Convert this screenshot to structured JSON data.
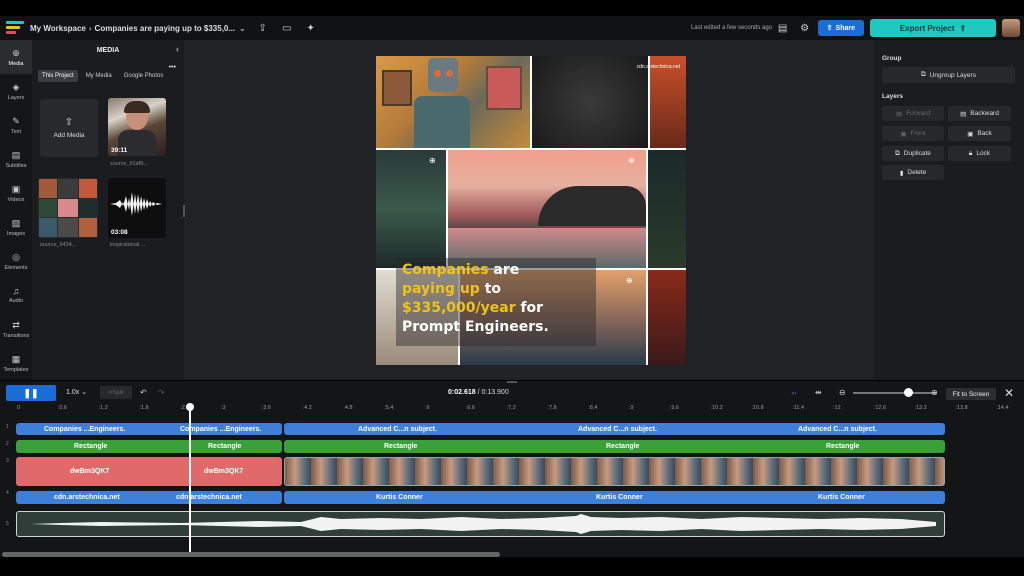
{
  "topbar": {
    "workspace": "My Workspace",
    "project": "Companies are paying up to $335,0...",
    "last_edited": "Last edited a few seconds ago",
    "share_label": "Share",
    "export_label": "Export Project",
    "logo_colors": [
      "#1fc8c0",
      "#f1c21b",
      "#e04f5f"
    ]
  },
  "leftnav": {
    "items": [
      {
        "label": "Media",
        "icon": "media-icon",
        "glyph": "⊕"
      },
      {
        "label": "Layers",
        "icon": "layers-icon",
        "glyph": "◈"
      },
      {
        "label": "Text",
        "icon": "text-icon",
        "glyph": "✎"
      },
      {
        "label": "Subtitles",
        "icon": "subtitles-icon",
        "glyph": "▤"
      },
      {
        "label": "Videos",
        "icon": "videos-icon",
        "glyph": "▣"
      },
      {
        "label": "Images",
        "icon": "images-icon",
        "glyph": "▨"
      },
      {
        "label": "Elements",
        "icon": "elements-icon",
        "glyph": "◎"
      },
      {
        "label": "Audio",
        "icon": "audio-icon",
        "glyph": "♫"
      },
      {
        "label": "Transitions",
        "icon": "transitions-icon",
        "glyph": "⇄"
      },
      {
        "label": "Templates",
        "icon": "templates-icon",
        "glyph": "▦"
      }
    ]
  },
  "media": {
    "title": "MEDIA",
    "tabs": [
      "This Project",
      "My Media",
      "Google Photos"
    ],
    "add_label": "Add Media",
    "items": [
      {
        "duration": "39:11",
        "caption": "source_61af9..."
      },
      {
        "duration": "",
        "caption": "source_6434..."
      },
      {
        "duration": "03:08",
        "caption": "inspirational ..."
      }
    ]
  },
  "canvas": {
    "url_text": "cdn.arstechnica.net",
    "caption": {
      "w1": "Companies",
      "w2": " are",
      "w3": "paying up",
      "w4": " to",
      "w5": "$335,000/year",
      "w6": " for",
      "w7": "Prompt Engineers."
    }
  },
  "right": {
    "group_label": "Group",
    "ungroup": "Ungroup Layers",
    "layers_label": "Layers",
    "forward": "Forward",
    "backward": "Backward",
    "front": "Front",
    "back": "Back",
    "duplicate": "Duplicate",
    "lock": "Lock",
    "delete": "Delete"
  },
  "timeline": {
    "speed": "1.0x",
    "split": "Split",
    "time_current": "0:02.618",
    "time_total": " / 0:13.900",
    "fit": "Fit to Screen",
    "ruler": [
      "0",
      ":0.6",
      ":1.2",
      ":1.8",
      ":2.4",
      ":3",
      ":3.6",
      ":4.2",
      ":4.8",
      ":5.4",
      ":6",
      ":6.6",
      ":7.2",
      ":7.8",
      ":8.4",
      ":9",
      ":9.6",
      ":10.2",
      ":10.8",
      ":11.4",
      ":12",
      ":12.6",
      ":13.2",
      ":13.8",
      ":14.4"
    ],
    "tracks": [
      "1",
      "2",
      "3",
      "4",
      "5"
    ],
    "text_clips": [
      "Companies ...Engineers.",
      "Companies ...Engineers.",
      "Advanced C...n subject.",
      "Advanced C...n subject.",
      "Advanced C...n subject."
    ],
    "rect_clips": [
      "Rectangle",
      "Rectangle",
      "Rectangle",
      "Rectangle",
      "Rectangle"
    ],
    "video_clips": [
      "dwBm3QK7",
      "dwBm3QK7"
    ],
    "credit_clips": [
      "cdn.arstechnica.net",
      "cdn.arstechnica.net",
      "Kurtis Conner",
      "Kurtis Conner",
      "Kurtis Conner"
    ],
    "colors": {
      "text": "#3e7fd9",
      "rect": "#3aa13a",
      "video": "#e06a6a",
      "credit": "#3e7fd9",
      "audio": "#2e3f3a"
    }
  }
}
